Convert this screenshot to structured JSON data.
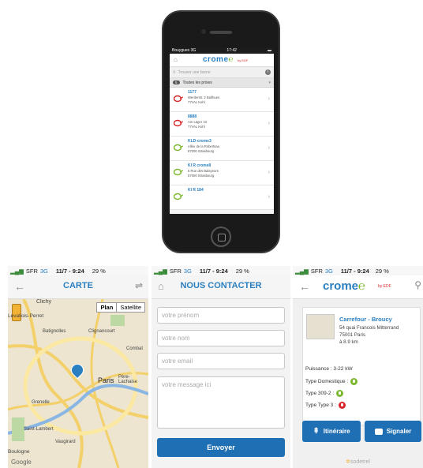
{
  "top_phone": {
    "status": {
      "carrier": "Bouygues",
      "network": "3G",
      "time": "17:42"
    },
    "brand": "crome",
    "brand_suffix": "by EDF",
    "search_placeholder": "Trouver une borne",
    "filter": {
      "count": "5",
      "label": "Toutes les prises"
    },
    "stations": [
      {
        "id": "1177",
        "lines": [
          "Werderstr. 2 Balthues",
          "77VAL Kehl"
        ],
        "color": "#d9262b"
      },
      {
        "id": "8888",
        "lines": [
          "Am Läger 10",
          "77VAL Kehl"
        ],
        "color": "#d9262b"
      },
      {
        "id": "KLD-crome3",
        "lines": [
          "Allée de la Robertsau",
          "67000 Strasbourg"
        ],
        "color": "#7cb82f"
      },
      {
        "id": "Kl R crome8",
        "lines": [
          "5 Rue des Balayeurs",
          "67000 Strasbourg"
        ],
        "color": "#7cb82f"
      },
      {
        "id": "Kl R 184",
        "lines": [],
        "color": "#7cb82f"
      }
    ]
  },
  "carte_screen": {
    "status": {
      "carrier": "SFR",
      "network": "3G",
      "time": "11/7 - 9:24",
      "battery": "29 %"
    },
    "title": "CARTE",
    "map_toggle": [
      "Plan",
      "Satellite"
    ],
    "map_labels": [
      "Clichy",
      "Batignolles",
      "Clignancourt",
      "Paris",
      "Grenelle",
      "Saint-Lambert",
      "Vaugirard",
      "Combat",
      "Père-Lachaise",
      "Levallois-Perret",
      "Boulogne",
      "Google"
    ]
  },
  "contact_screen": {
    "status": {
      "carrier": "SFR",
      "network": "3G",
      "time": "11/7 - 9:24",
      "battery": "29 %"
    },
    "title": "NOUS CONTACTER",
    "first_name_placeholder": "votre prénom",
    "last_name_placeholder": "votre nom",
    "email_placeholder": "votre email",
    "message_placeholder": "votre message ici",
    "submit_label": "Envoyer"
  },
  "detail_screen": {
    "status": {
      "carrier": "SFR",
      "network": "3G",
      "time": "11/7 - 9:24",
      "battery": "29 %"
    },
    "brand": "crome",
    "station_name": "Carrefour - Broucy",
    "address_line1": "54 quai Francois Mitterrand",
    "address_line2": "75001 Paris",
    "distance": "à 8.9 km",
    "power": "Puissance : 3-22 kW",
    "plug_domestic": "Type Domestique :",
    "plug_309": "Type 309-2 :",
    "plug_type3": "Type Type 3 :",
    "itinerary_label": "Itinéraire",
    "report_label": "Signaler",
    "footer": "sodetrel"
  },
  "colors": {
    "brand_blue": "#2a7fc0",
    "available_green": "#7cb82f",
    "unavailable_red": "#d9262b",
    "button_blue": "#1f6fb5"
  }
}
